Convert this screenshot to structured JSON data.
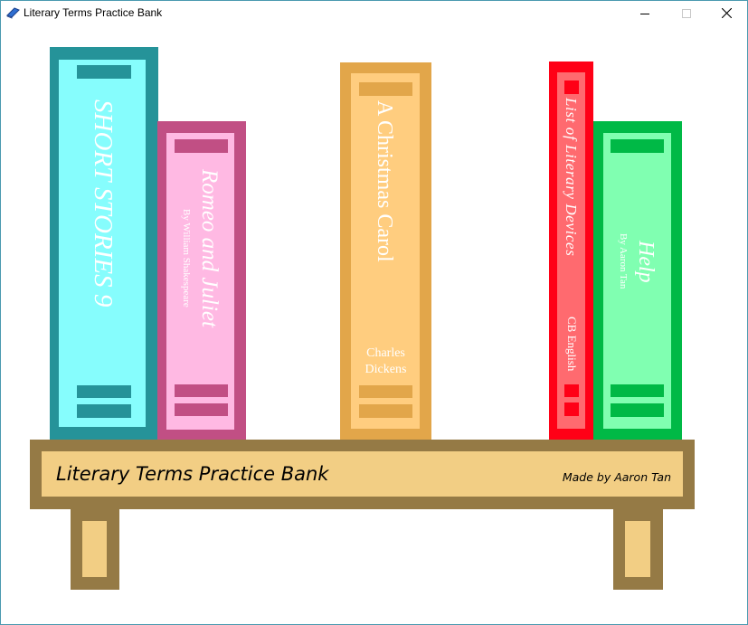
{
  "window": {
    "title": "Literary Terms Practice Bank",
    "icon": "book-icon",
    "controls": [
      "minimize-icon",
      "maximize-icon",
      "close-icon"
    ]
  },
  "books": [
    {
      "id": "short-stories",
      "title": "SHORT STORIES 9",
      "author": "",
      "colors": {
        "outer": "#259399",
        "inner": "#86fdfd",
        "bar": "#259399"
      }
    },
    {
      "id": "romeo-juliet",
      "title": "Romeo and Juliet",
      "author": "By William Shakespeare",
      "colors": {
        "outer": "#c14f84",
        "inner": "#ffb9e3",
        "bar": "#c14f84"
      }
    },
    {
      "id": "christmas-carol",
      "title": "A Christmas Carol",
      "author": "Charles Dickens",
      "colors": {
        "outer": "#e2a64a",
        "inner": "#ffcd7f",
        "bar": "#e2a64a"
      }
    },
    {
      "id": "literary-devices",
      "title": "List of Literary Devices",
      "author": "CB English",
      "colors": {
        "outer": "#ff0016",
        "inner": "#ff6a6f",
        "bar": "#ff0016"
      }
    },
    {
      "id": "help",
      "title": "Help",
      "author": "By Aaron Tan",
      "colors": {
        "outer": "#00b946",
        "inner": "#80ffb1",
        "bar": "#00b946"
      }
    }
  ],
  "shelf": {
    "title": "Literary Terms Practice Bank",
    "credit": "Made by Aaron Tan",
    "colors": {
      "wood": "#957a45",
      "panel": "#f2ce84"
    }
  }
}
